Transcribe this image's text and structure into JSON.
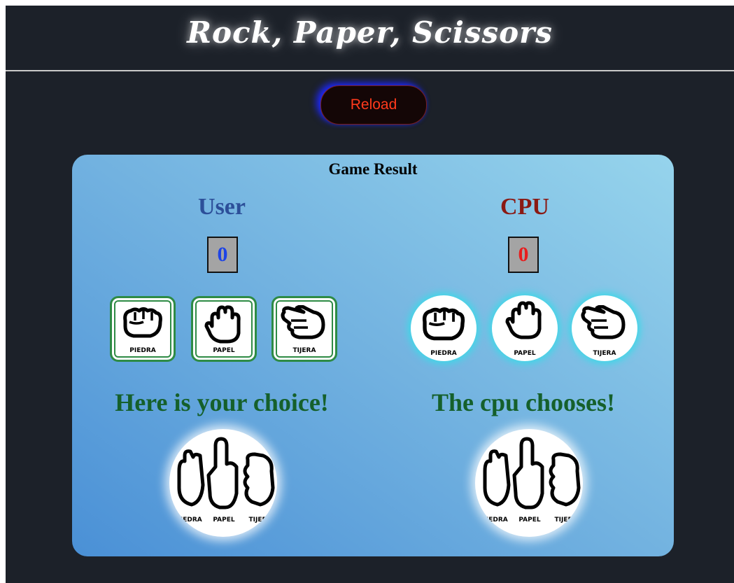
{
  "header": {
    "title": "Rock, Paper, Scissors"
  },
  "controls": {
    "reload_label": "Reload"
  },
  "game": {
    "result_title": "Game Result",
    "user": {
      "title": "User",
      "title_color": "#2c4f99",
      "score": "0",
      "score_color": "#1e44e6",
      "message": "Here is your choice!",
      "choices": [
        {
          "icon": "rock-hand-icon",
          "label": "PIEDRA"
        },
        {
          "icon": "paper-hand-icon",
          "label": "PAPEL"
        },
        {
          "icon": "scissors-hand-icon",
          "label": "TIJERA"
        }
      ],
      "animation_labels": [
        "PIEDRA",
        "PAPEL",
        "TIJERA"
      ]
    },
    "cpu": {
      "title": "CPU",
      "title_color": "#8a1a14",
      "score": "0",
      "score_color": "#e81e1e",
      "message": "The cpu chooses!",
      "choices": [
        {
          "icon": "rock-hand-icon",
          "label": "PIEDRA"
        },
        {
          "icon": "paper-hand-icon",
          "label": "PAPEL"
        },
        {
          "icon": "scissors-hand-icon",
          "label": "TIJERA"
        }
      ],
      "animation_labels": [
        "PIEDRA",
        "PAPEL",
        "TIJERA"
      ]
    }
  },
  "colors": {
    "background": "#1c2129",
    "reload_text": "#ff3a1c",
    "message": "#15602b",
    "user_button_border": "#2e8b45",
    "cpu_glow": "#3fd8e8"
  }
}
